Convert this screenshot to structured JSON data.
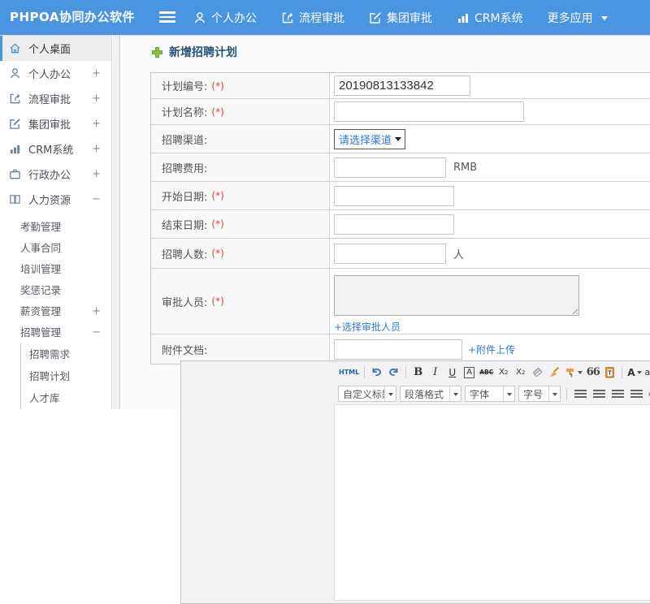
{
  "app": {
    "logo_text": "PHPOA协同办公软件"
  },
  "topnav": {
    "menu": [
      {
        "label": "个人办公"
      },
      {
        "label": "流程审批"
      },
      {
        "label": "集团审批"
      },
      {
        "label": "CRM系统"
      },
      {
        "label": "更多应用"
      }
    ]
  },
  "sidebar": {
    "top_items": [
      {
        "label": "个人桌面",
        "expand": ""
      },
      {
        "label": "个人办公",
        "expand": "+"
      },
      {
        "label": "流程审批",
        "expand": "+"
      },
      {
        "label": "集团审批",
        "expand": "+"
      },
      {
        "label": "CRM系统",
        "expand": "+"
      },
      {
        "label": "行政办公",
        "expand": "+"
      },
      {
        "label": "人力资源",
        "expand": "−"
      }
    ],
    "hr_items": [
      {
        "label": "考勤管理",
        "expand": ""
      },
      {
        "label": "人事合同",
        "expand": ""
      },
      {
        "label": "培训管理",
        "expand": ""
      },
      {
        "label": "奖惩记录",
        "expand": ""
      },
      {
        "label": "薪资管理",
        "expand": "+"
      },
      {
        "label": "招聘管理",
        "expand": "−"
      }
    ],
    "recruit_items": [
      {
        "label": "招聘需求"
      },
      {
        "label": "招聘计划"
      },
      {
        "label": "人才库"
      }
    ]
  },
  "main": {
    "title": "新增招聘计划",
    "form": {
      "required_mark": "(*)",
      "plan_no": {
        "label": "计划编号:",
        "value": "20190813133842"
      },
      "plan_name": {
        "label": "计划名称:"
      },
      "channel": {
        "label": "招聘渠道:",
        "select_value": "请选择渠道"
      },
      "fee": {
        "label": "招聘费用:",
        "unit": "RMB"
      },
      "start_date": {
        "label": "开始日期:"
      },
      "end_date": {
        "label": "结束日期:"
      },
      "headcount": {
        "label": "招聘人数:",
        "unit": "人"
      },
      "approvers": {
        "label": "审批人员:",
        "link": "+选择审批人员"
      },
      "attachment": {
        "label": "附件文档:",
        "link": "+附件上传"
      }
    },
    "editor": {
      "html_label": "HTML",
      "bold": "B",
      "italic": "I",
      "underline": "U",
      "fontborder": "A",
      "strike": "ABC",
      "sup": "X",
      "sup_s": "2",
      "sub": "X",
      "sub_s": "2",
      "quote": "66",
      "fontcolor": "A",
      "highlight": "ab",
      "selects": [
        {
          "label": "自定义标题"
        },
        {
          "label": "段落格式"
        },
        {
          "label": "字体"
        },
        {
          "label": "字号"
        }
      ]
    }
  },
  "colors": {
    "header_blue": "#4a95e1",
    "link_blue": "#2e7cd5",
    "required_red": "#e24040",
    "title_navy": "#29517d"
  }
}
